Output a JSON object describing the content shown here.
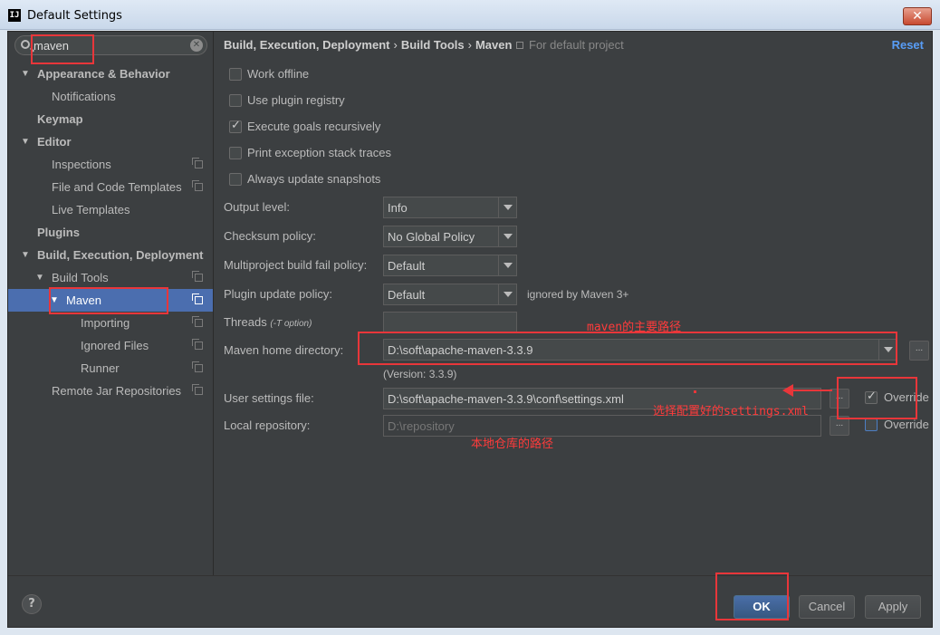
{
  "window": {
    "title": "Default Settings",
    "app_icon": "IJ",
    "close": "✕"
  },
  "search": {
    "value": "maven",
    "placeholder": ""
  },
  "tree": [
    {
      "label": "Appearance & Behavior",
      "level": 0,
      "expanded": true,
      "bold": true
    },
    {
      "label": "Notifications",
      "level": 1
    },
    {
      "label": "Keymap",
      "level": 0,
      "bold": true
    },
    {
      "label": "Editor",
      "level": 0,
      "expanded": true,
      "bold": true
    },
    {
      "label": "Inspections",
      "level": 1,
      "copy_icon": true
    },
    {
      "label": "File and Code Templates",
      "level": 1,
      "copy_icon": true
    },
    {
      "label": "Live Templates",
      "level": 1
    },
    {
      "label": "Plugins",
      "level": 0,
      "bold": true
    },
    {
      "label": "Build, Execution, Deployment",
      "level": 0,
      "expanded": true,
      "bold": true
    },
    {
      "label": "Build Tools",
      "level": 1,
      "expanded": true,
      "copy_icon": true
    },
    {
      "label": "Maven",
      "level": 2,
      "expanded": true,
      "selected": true,
      "copy_icon": true
    },
    {
      "label": "Importing",
      "level": 3,
      "copy_icon": true
    },
    {
      "label": "Ignored Files",
      "level": 3,
      "copy_icon": true
    },
    {
      "label": "Runner",
      "level": 3,
      "copy_icon": true
    },
    {
      "label": "Remote Jar Repositories",
      "level": 1,
      "copy_icon": true
    }
  ],
  "breadcrumb": {
    "parts": [
      "Build, Execution, Deployment",
      "Build Tools",
      "Maven"
    ],
    "separator": "›",
    "scope": "For default project",
    "reset": "Reset"
  },
  "options": [
    {
      "label": "Work offline",
      "checked": false
    },
    {
      "label": "Use plugin registry",
      "checked": false
    },
    {
      "label": "Execute goals recursively",
      "checked": true
    },
    {
      "label": "Print exception stack traces",
      "checked": false
    },
    {
      "label": "Always update snapshots",
      "checked": false
    }
  ],
  "form": {
    "output_level": {
      "label": "Output level:",
      "value": "Info"
    },
    "checksum_policy": {
      "label": "Checksum policy:",
      "value": "No Global Policy"
    },
    "fail_policy": {
      "label": "Multiproject build fail policy:",
      "value": "Default"
    },
    "plugin_update": {
      "label": "Plugin update policy:",
      "value": "Default",
      "note": "ignored by Maven 3+"
    },
    "threads": {
      "label": "Threads",
      "hint": "(-T option)",
      "value": ""
    },
    "maven_home": {
      "label": "Maven home directory:",
      "value": "D:\\soft\\apache-maven-3.3.9",
      "version": "(Version: 3.3.9)"
    },
    "user_settings": {
      "label": "User settings file:",
      "value": "D:\\soft\\apache-maven-3.3.9\\conf\\settings.xml",
      "override_label": "Override",
      "override_checked": true
    },
    "local_repo": {
      "label": "Local repository:",
      "value": "D:\\repository",
      "override_label": "Override",
      "override_checked": false
    },
    "browse": "..."
  },
  "footer": {
    "help": "?",
    "ok": "OK",
    "cancel": "Cancel",
    "apply": "Apply"
  },
  "annotations": {
    "maven_home": "maven的主要路径",
    "settings": "选择配置好的settings.xml",
    "local_repo": "本地仓库的路径",
    "color": "#e8363a"
  }
}
